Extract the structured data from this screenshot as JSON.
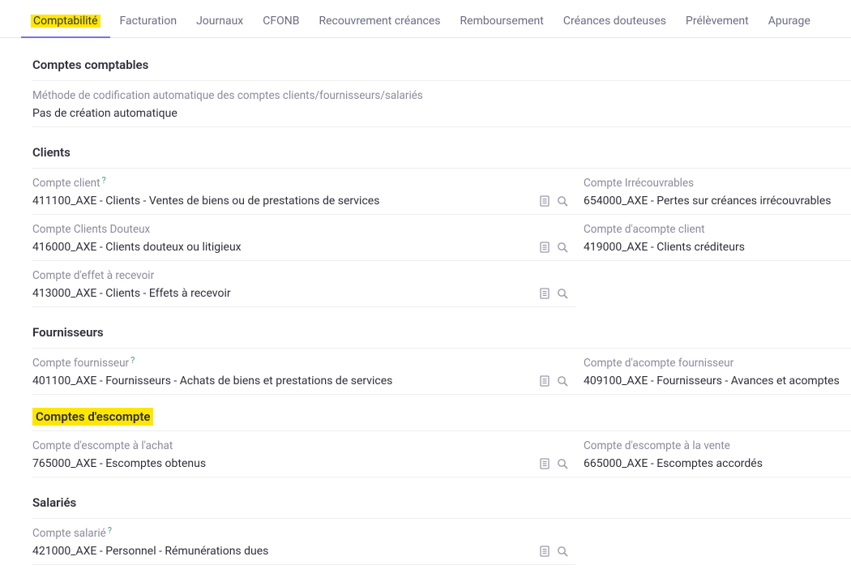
{
  "tabs": [
    {
      "label": "Comptabilité",
      "active": true,
      "highlight": true
    },
    {
      "label": "Facturation"
    },
    {
      "label": "Journaux"
    },
    {
      "label": "CFONB"
    },
    {
      "label": "Recouvrement créances"
    },
    {
      "label": "Remboursement"
    },
    {
      "label": "Créances douteuses"
    },
    {
      "label": "Prélèvement"
    },
    {
      "label": "Apurage "
    }
  ],
  "sections": {
    "comptes_comptables": {
      "title": "Comptes comptables",
      "method_label": "Méthode de codification automatique des comptes clients/fournisseurs/salariés",
      "method_value": "Pas de création automatique"
    },
    "clients": {
      "title": "Clients",
      "compte_client_label": "Compte client",
      "compte_client_value": "411100_AXE - Clients - Ventes de biens ou de prestations de services",
      "compte_irrecouvrables_label": "Compte Irrécouvrables",
      "compte_irrecouvrables_value": "654000_AXE - Pertes sur créances irrécouvrables",
      "compte_douteux_label": "Compte Clients Douteux",
      "compte_douteux_value": "416000_AXE - Clients douteux ou litigieux",
      "compte_acompte_label": "Compte d'acompte client",
      "compte_acompte_value": "419000_AXE - Clients créditeurs",
      "compte_effet_label": "Compte d'effet à recevoir",
      "compte_effet_value": "413000_AXE - Clients - Effets à recevoir"
    },
    "fournisseurs": {
      "title": "Fournisseurs",
      "compte_fournisseur_label": "Compte fournisseur",
      "compte_fournisseur_value": "401100_AXE - Fournisseurs - Achats de biens et prestations de services",
      "compte_acompte_fourn_label": "Compte d'acompte fournisseur",
      "compte_acompte_fourn_value": "409100_AXE - Fournisseurs - Avances et acomptes"
    },
    "escompte": {
      "title": "Comptes d'escompte",
      "achat_label": "Compte d'escompte à l'achat",
      "achat_value": "765000_AXE - Escomptes obtenus",
      "vente_label": "Compte d'escompte à la vente",
      "vente_value": "665000_AXE - Escomptes accordés"
    },
    "salaries": {
      "title": "Salariés",
      "compte_salarie_label": "Compte salarié",
      "compte_salarie_value": "421000_AXE - Personnel - Rémunérations dues"
    }
  },
  "help_marker": "?"
}
